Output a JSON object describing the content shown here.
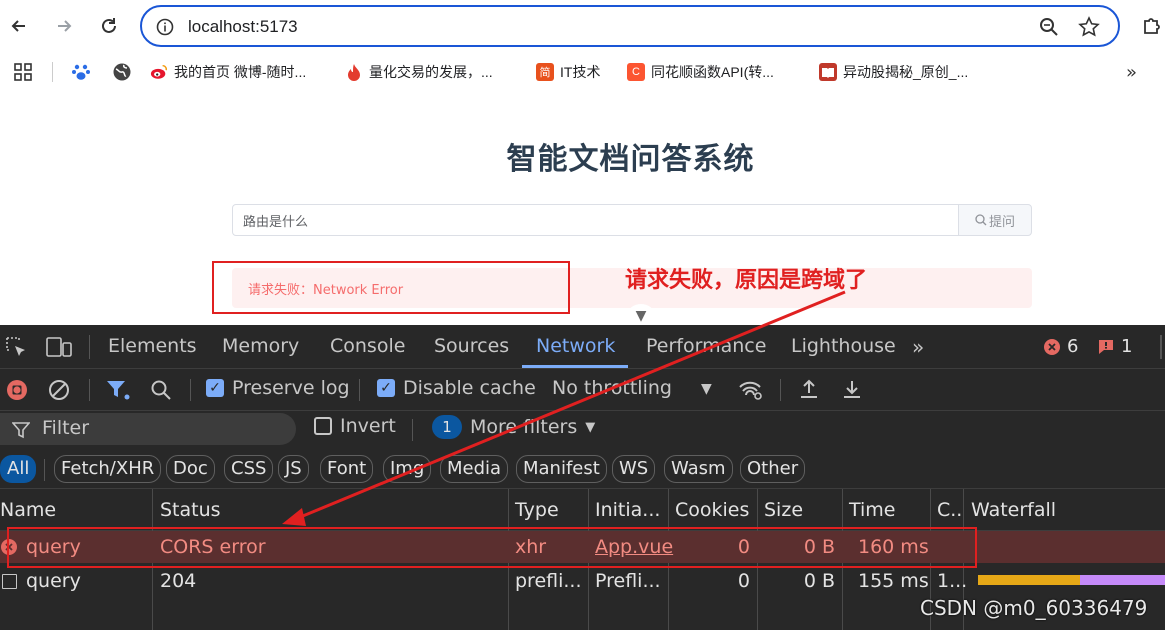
{
  "browser": {
    "url": "localhost:5173",
    "bookmarks": [
      {
        "label": "我的首页 微博-随时...",
        "icon": "weibo-icon",
        "color": "#e6162d"
      },
      {
        "label": "量化交易的发展，...",
        "icon": "flame-icon",
        "color": "#e33b2e"
      },
      {
        "label": "IT技术",
        "icon": "jian-icon",
        "fav": "简",
        "color": "#e8511d"
      },
      {
        "label": "同花顺函数API(转...",
        "icon": "csdn-c-icon",
        "fav": "C",
        "color": "#fc5531"
      },
      {
        "label": "异动股揭秘_原创_...",
        "icon": "book-icon",
        "color": "#c0392b"
      }
    ]
  },
  "app": {
    "title": "智能文档问答系统",
    "input_value": "路由是什么",
    "ask_label": "提问",
    "error_text": "请求失败：Network Error"
  },
  "annotation": {
    "text": "请求失败，原因是跨域了",
    "color": "#e02020"
  },
  "devtools": {
    "tabs": [
      "Elements",
      "Memory",
      "Console",
      "Sources",
      "Network",
      "Performance",
      "Lighthouse"
    ],
    "active_tab": "Network",
    "error_count": "6",
    "issue_count": "1",
    "toolbar": {
      "preserve_log": "Preserve log",
      "disable_cache": "Disable cache",
      "throttling": "No throttling"
    },
    "filter": {
      "placeholder": "Filter",
      "invert": "Invert",
      "more_filters_count": "1",
      "more_filters": "More filters"
    },
    "types": [
      "All",
      "Fetch/XHR",
      "Doc",
      "CSS",
      "JS",
      "Font",
      "Img",
      "Media",
      "Manifest",
      "WS",
      "Wasm",
      "Other"
    ],
    "columns": [
      "Name",
      "Status",
      "Type",
      "Initia...",
      "Cookies",
      "Size",
      "Time",
      "C..",
      "Waterfall"
    ],
    "rows": [
      {
        "name": "query",
        "status": "CORS error",
        "type": "xhr",
        "initiator": "App.vue",
        "cookies": "0",
        "size": "0 B",
        "time": "160 ms",
        "c": ""
      },
      {
        "name": "query",
        "status": "204",
        "type": "prefli...",
        "initiator": "Prefli...",
        "cookies": "0",
        "size": "0 B",
        "time": "155 ms",
        "c": "1..."
      }
    ]
  },
  "watermark": "CSDN @m0_60336479"
}
